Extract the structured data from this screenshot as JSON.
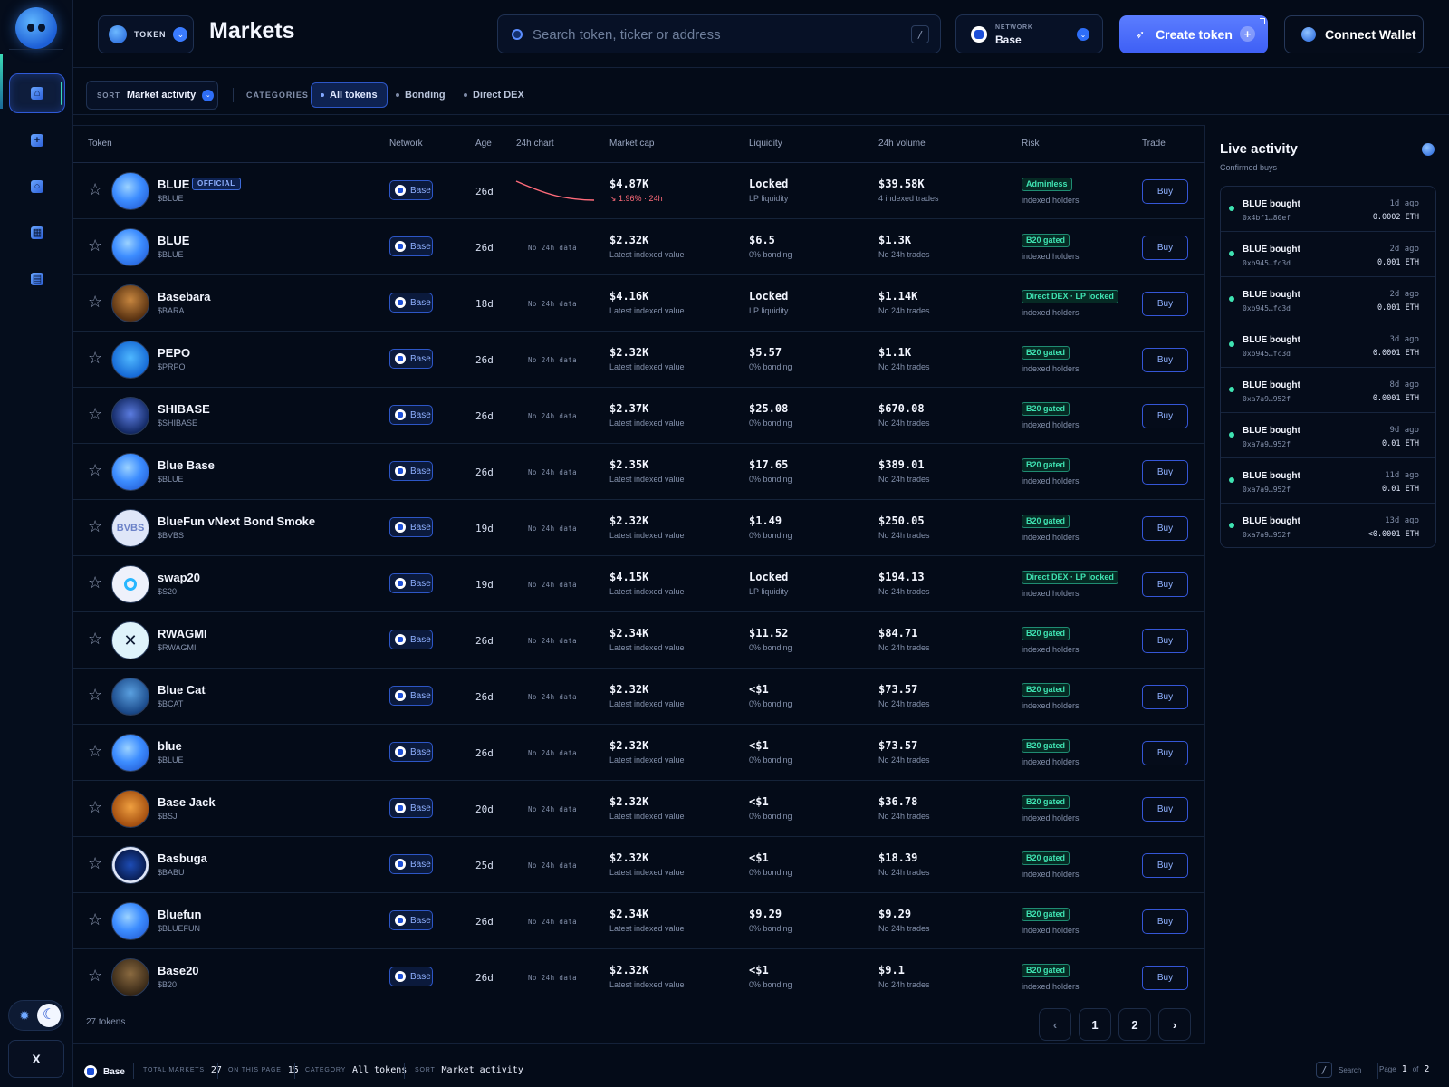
{
  "header": {
    "token_label": "TOKEN",
    "title": "Markets",
    "search_placeholder": "Search token, ticker or address",
    "search_shortcut": "/",
    "network_caption": "NETWORK",
    "network_value": "Base",
    "create_label": "Create token",
    "connect_label": "Connect Wallet"
  },
  "filters": {
    "sort_caption": "SORT",
    "sort_value": "Market activity",
    "categories_caption": "CATEGORIES",
    "tabs": [
      "All tokens",
      "Bonding",
      "Direct DEX"
    ],
    "active_tab": "All tokens"
  },
  "table": {
    "headers": [
      "Token",
      "Network",
      "Age",
      "24h chart",
      "Market cap",
      "Liquidity",
      "24h volume",
      "Risk",
      "Trade"
    ],
    "official_label": "OFFICIAL",
    "buy_label": "Buy",
    "rows": [
      {
        "name": "BLUE",
        "symbol": "$BLUE",
        "network": "Base",
        "age": "26d",
        "chart": "",
        "mcap": "$4.87K",
        "mcap_sub": "↘ 1.96% · 24h",
        "liq": "Locked",
        "liq_sub": "LP liquidity",
        "vol": "$39.58K",
        "vol_sub": "4 indexed trades",
        "risk": "Adminless",
        "risk_sub": "indexed holders"
      },
      {
        "name": "BLUE",
        "symbol": "$BLUE",
        "network": "Base",
        "age": "26d",
        "chart": "No 24h data",
        "mcap": "$2.32K",
        "mcap_sub": "Latest indexed value",
        "liq": "$6.5",
        "liq_sub": "0% bonding",
        "vol": "$1.3K",
        "vol_sub": "No 24h trades",
        "risk": "B20 gated",
        "risk_sub": "indexed holders"
      },
      {
        "name": "Basebara",
        "symbol": "$BARA",
        "network": "Base",
        "age": "18d",
        "chart": "No 24h data",
        "mcap": "$4.16K",
        "mcap_sub": "Latest indexed value",
        "liq": "Locked",
        "liq_sub": "LP liquidity",
        "vol": "$1.14K",
        "vol_sub": "No 24h trades",
        "risk": "Direct DEX · LP locked",
        "risk_sub": "indexed holders"
      },
      {
        "name": "PEPO",
        "symbol": "$PRPO",
        "network": "Base",
        "age": "26d",
        "chart": "No 24h data",
        "mcap": "$2.32K",
        "mcap_sub": "Latest indexed value",
        "liq": "$5.57",
        "liq_sub": "0% bonding",
        "vol": "$1.1K",
        "vol_sub": "No 24h trades",
        "risk": "B20 gated",
        "risk_sub": "indexed holders"
      },
      {
        "name": "SHIBASE",
        "symbol": "$SHIBASE",
        "network": "Base",
        "age": "26d",
        "chart": "No 24h data",
        "mcap": "$2.37K",
        "mcap_sub": "Latest indexed value",
        "liq": "$25.08",
        "liq_sub": "0% bonding",
        "vol": "$670.08",
        "vol_sub": "No 24h trades",
        "risk": "B20 gated",
        "risk_sub": "indexed holders"
      },
      {
        "name": "Blue Base",
        "symbol": "$BLUE",
        "network": "Base",
        "age": "26d",
        "chart": "No 24h data",
        "mcap": "$2.35K",
        "mcap_sub": "Latest indexed value",
        "liq": "$17.65",
        "liq_sub": "0% bonding",
        "vol": "$389.01",
        "vol_sub": "No 24h trades",
        "risk": "B20 gated",
        "risk_sub": "indexed holders"
      },
      {
        "name": "BlueFun vNext Bond Smoke",
        "symbol": "$BVBS",
        "network": "Base",
        "age": "19d",
        "chart": "No 24h data",
        "mcap": "$2.32K",
        "mcap_sub": "Latest indexed value",
        "liq": "$1.49",
        "liq_sub": "0% bonding",
        "vol": "$250.05",
        "vol_sub": "No 24h trades",
        "risk": "B20 gated",
        "risk_sub": "indexed holders"
      },
      {
        "name": "swap20",
        "symbol": "$S20",
        "network": "Base",
        "age": "19d",
        "chart": "No 24h data",
        "mcap": "$4.15K",
        "mcap_sub": "Latest indexed value",
        "liq": "Locked",
        "liq_sub": "LP liquidity",
        "vol": "$194.13",
        "vol_sub": "No 24h trades",
        "risk": "Direct DEX · LP locked",
        "risk_sub": "indexed holders"
      },
      {
        "name": "RWAGMI",
        "symbol": "$RWAGMI",
        "network": "Base",
        "age": "26d",
        "chart": "No 24h data",
        "mcap": "$2.34K",
        "mcap_sub": "Latest indexed value",
        "liq": "$11.52",
        "liq_sub": "0% bonding",
        "vol": "$84.71",
        "vol_sub": "No 24h trades",
        "risk": "B20 gated",
        "risk_sub": "indexed holders"
      },
      {
        "name": "Blue Cat",
        "symbol": "$BCAT",
        "network": "Base",
        "age": "26d",
        "chart": "No 24h data",
        "mcap": "$2.32K",
        "mcap_sub": "Latest indexed value",
        "liq": "<$1",
        "liq_sub": "0% bonding",
        "vol": "$73.57",
        "vol_sub": "No 24h trades",
        "risk": "B20 gated",
        "risk_sub": "indexed holders"
      },
      {
        "name": "blue",
        "symbol": "$BLUE",
        "network": "Base",
        "age": "26d",
        "chart": "No 24h data",
        "mcap": "$2.32K",
        "mcap_sub": "Latest indexed value",
        "liq": "<$1",
        "liq_sub": "0% bonding",
        "vol": "$73.57",
        "vol_sub": "No 24h trades",
        "risk": "B20 gated",
        "risk_sub": "indexed holders"
      },
      {
        "name": "Base Jack",
        "symbol": "$BSJ",
        "network": "Base",
        "age": "20d",
        "chart": "No 24h data",
        "mcap": "$2.32K",
        "mcap_sub": "Latest indexed value",
        "liq": "<$1",
        "liq_sub": "0% bonding",
        "vol": "$36.78",
        "vol_sub": "No 24h trades",
        "risk": "B20 gated",
        "risk_sub": "indexed holders"
      },
      {
        "name": "Basbuga",
        "symbol": "$BABU",
        "network": "Base",
        "age": "25d",
        "chart": "No 24h data",
        "mcap": "$2.32K",
        "mcap_sub": "Latest indexed value",
        "liq": "<$1",
        "liq_sub": "0% bonding",
        "vol": "$18.39",
        "vol_sub": "No 24h trades",
        "risk": "B20 gated",
        "risk_sub": "indexed holders"
      },
      {
        "name": "Bluefun",
        "symbol": "$BLUEFUN",
        "network": "Base",
        "age": "26d",
        "chart": "No 24h data",
        "mcap": "$2.34K",
        "mcap_sub": "Latest indexed value",
        "liq": "$9.29",
        "liq_sub": "0% bonding",
        "vol": "$9.29",
        "vol_sub": "No 24h trades",
        "risk": "B20 gated",
        "risk_sub": "indexed holders"
      },
      {
        "name": "Base20",
        "symbol": "$B20",
        "network": "Base",
        "age": "26d",
        "chart": "No 24h data",
        "mcap": "$2.32K",
        "mcap_sub": "Latest indexed value",
        "liq": "<$1",
        "liq_sub": "0% bonding",
        "vol": "$9.1",
        "vol_sub": "No 24h trades",
        "risk": "B20 gated",
        "risk_sub": "indexed holders"
      }
    ],
    "count_label": "27 tokens",
    "pagination": {
      "prev": "‹",
      "pages": [
        "1",
        "2"
      ],
      "next": "›"
    }
  },
  "live": {
    "title": "Live activity",
    "subtitle": "Confirmed buys",
    "items": [
      {
        "label": "BLUE bought",
        "addr": "0x4bf1…80ef",
        "time": "1d ago",
        "amount": "0.0002 ETH"
      },
      {
        "label": "BLUE bought",
        "addr": "0xb945…fc3d",
        "time": "2d ago",
        "amount": "0.001 ETH"
      },
      {
        "label": "BLUE bought",
        "addr": "0xb945…fc3d",
        "time": "2d ago",
        "amount": "0.001 ETH"
      },
      {
        "label": "BLUE bought",
        "addr": "0xb945…fc3d",
        "time": "3d ago",
        "amount": "0.0001 ETH"
      },
      {
        "label": "BLUE bought",
        "addr": "0xa7a9…952f",
        "time": "8d ago",
        "amount": "0.0001 ETH"
      },
      {
        "label": "BLUE bought",
        "addr": "0xa7a9…952f",
        "time": "9d ago",
        "amount": "0.01 ETH"
      },
      {
        "label": "BLUE bought",
        "addr": "0xa7a9…952f",
        "time": "11d ago",
        "amount": "0.01 ETH"
      },
      {
        "label": "BLUE bought",
        "addr": "0xa7a9…952f",
        "time": "13d ago",
        "amount": "<0.0001 ETH"
      }
    ]
  },
  "statusbar": {
    "network": "Base",
    "total_caption": "TOTAL MARKETS",
    "total_value": "27",
    "page_caption": "ON THIS PAGE",
    "page_value": "15",
    "category_caption": "CATEGORY",
    "category_value": "All tokens",
    "sort_caption": "SORT",
    "sort_value": "Market activity",
    "search_key": "/",
    "search_label": "Search",
    "page_label": "Page",
    "page_current": "1",
    "page_of": "of",
    "page_total": "2"
  },
  "rail": {
    "x_label": "X"
  },
  "colors": {
    "background": "#040b18",
    "accent": "#3e5ff5",
    "risk_green": "#3fe3b2",
    "negative": "#ff6b7a"
  },
  "icons": [
    "logo-icon",
    "home-icon",
    "plus-icon",
    "search-icon",
    "grid-icon",
    "document-icon",
    "sun-icon",
    "moon-icon",
    "star-icon",
    "rocket-icon",
    "wallet-icon",
    "chevron-down-icon"
  ]
}
